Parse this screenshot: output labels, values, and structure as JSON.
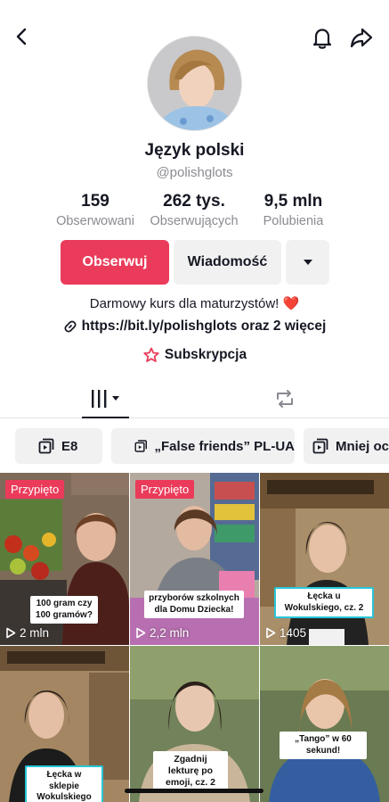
{
  "profile": {
    "name": "Język polski",
    "handle": "@polishglots",
    "stats": [
      {
        "value": "159",
        "label": "Obserwowani"
      },
      {
        "value": "262 tys.",
        "label": "Obserwujących"
      },
      {
        "value": "9,5 mln",
        "label": "Polubienia"
      }
    ],
    "follow_label": "Obserwuj",
    "message_label": "Wiadomość",
    "bio": "Darmowy kurs dla maturzystów! ❤️",
    "link": "https://bit.ly/polishglots oraz 2 więcej",
    "subscription_label": "Subskrypcja"
  },
  "playlists": [
    {
      "label": "E8"
    },
    {
      "label": "„False friends” PL-UA"
    },
    {
      "label": "Mniej oc"
    }
  ],
  "videos": [
    {
      "pinned": "Przypięto",
      "views": "2 mln",
      "caption": "100 gram czy 100 gramów?"
    },
    {
      "pinned": "Przypięto",
      "views": "2,2 mln",
      "caption": "przyborów szkolnych dla Domu Dziecka!"
    },
    {
      "views": "1405",
      "caption": "Łęcka u Wokulskiego, cz. 2"
    },
    {
      "caption": "Łęcka w sklepie Wokulskiego"
    },
    {
      "caption": "Zgadnij lekturę po emoji, cz. 2"
    },
    {
      "caption": "„Tango” w 60 sekund!"
    }
  ],
  "colors": {
    "accent": "#ea3b5a",
    "muted": "#8a8b91",
    "chip_bg": "#f1f1f2"
  }
}
